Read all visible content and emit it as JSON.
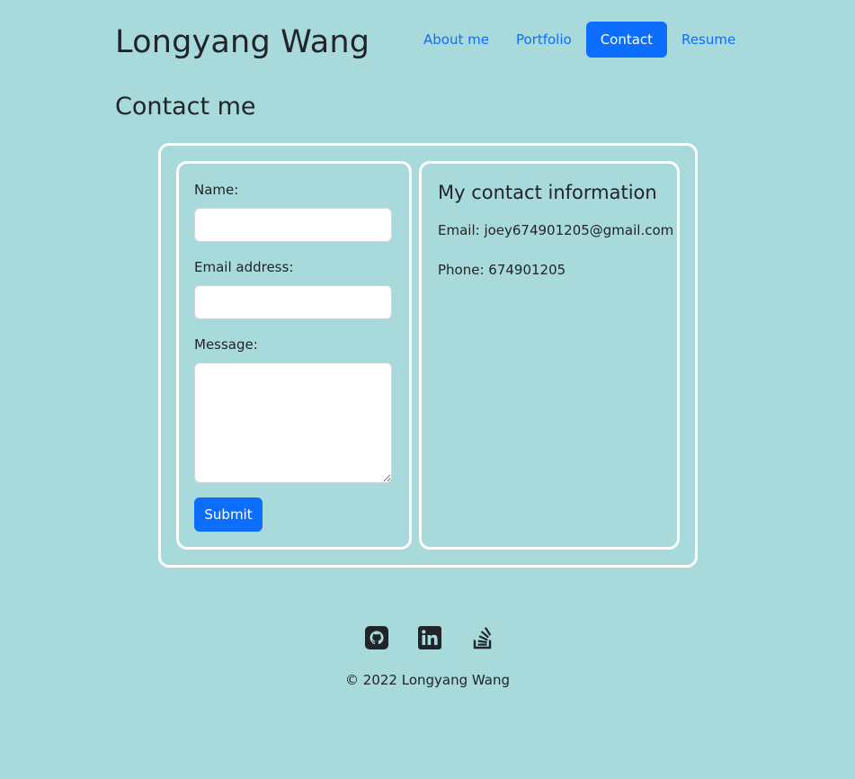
{
  "header": {
    "site_title": "Longyang Wang",
    "nav": [
      {
        "label": "About me",
        "active": false
      },
      {
        "label": "Portfolio",
        "active": false
      },
      {
        "label": "Contact",
        "active": true
      },
      {
        "label": "Resume",
        "active": false
      }
    ]
  },
  "page": {
    "title": "Contact me"
  },
  "form": {
    "name_label": "Name:",
    "name_value": "",
    "email_label": "Email address:",
    "email_value": "",
    "message_label": "Message:",
    "message_value": "",
    "submit_label": "Submit"
  },
  "contact_info": {
    "title": "My contact information",
    "email_line": "Email: joey674901205@gmail.com",
    "phone_line": "Phone: 674901205"
  },
  "footer": {
    "icons": [
      "github-icon",
      "linkedin-icon",
      "stack-overflow-icon"
    ],
    "copyright": "© 2022 Longyang Wang"
  },
  "colors": {
    "background": "#a8d9db",
    "accent": "#0d6efd",
    "text": "#212529",
    "border": "#ffffff"
  }
}
